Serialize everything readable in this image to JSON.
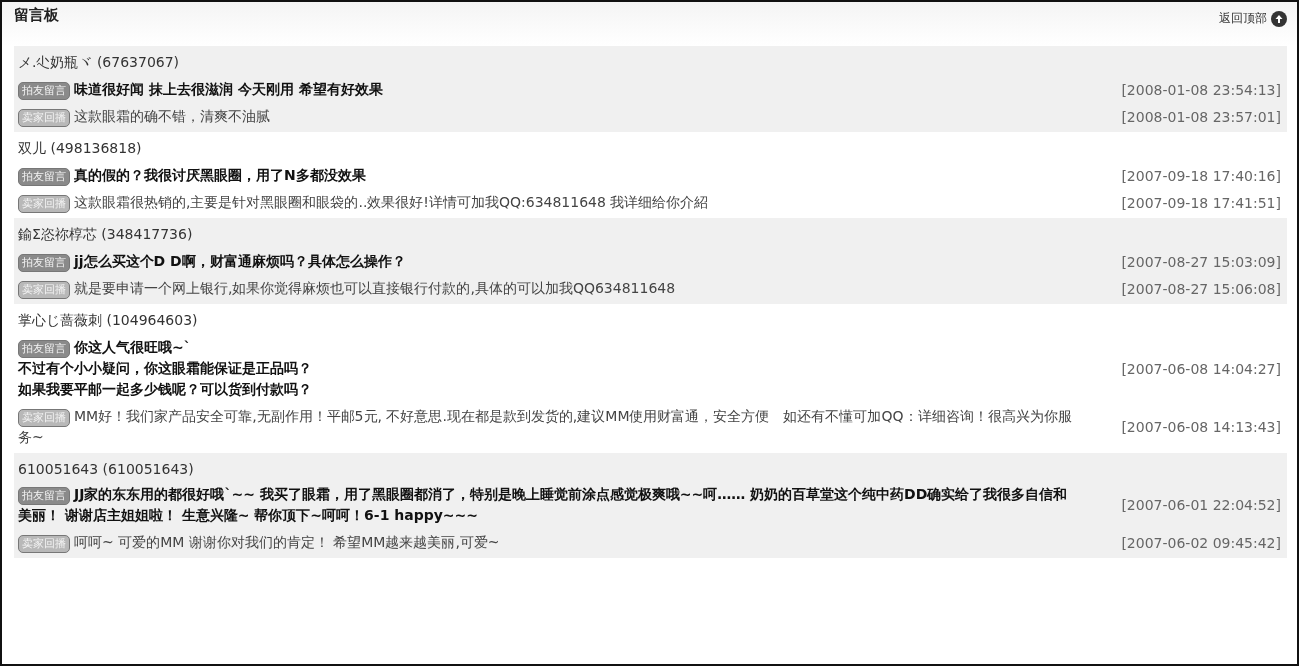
{
  "board": {
    "title": "留言板",
    "back_to_top": "返回顶部"
  },
  "threads": [
    {
      "author": "メ.尐奶瓶ヾ (67637067)",
      "messages": [
        {
          "kind": "buyer",
          "badge": "拍友留言",
          "text": "味道很好闻 抹上去很滋润 今天刚用 希望有好效果",
          "time": "[2008-01-08 23:54:13]"
        },
        {
          "kind": "seller",
          "badge": "卖家回播",
          "text": "这款眼霜的确不错，清爽不油腻",
          "time": "[2008-01-08 23:57:01]"
        }
      ]
    },
    {
      "author": "双儿 (498136818)",
      "messages": [
        {
          "kind": "buyer",
          "badge": "拍友留言",
          "text": "真的假的？我很讨厌黑眼圈，用了N多都没效果",
          "time": "[2007-09-18 17:40:16]"
        },
        {
          "kind": "seller",
          "badge": "卖家回播",
          "text": "这款眼霜很热销的,主要是针对黑眼圈和眼袋的..效果很好!详情可加我QQ:634811648 我详细给你介紹",
          "time": "[2007-09-18 17:41:51]"
        }
      ]
    },
    {
      "author": "鍮Σ恣祢椁芯 (348417736)",
      "messages": [
        {
          "kind": "buyer",
          "badge": "拍友留言",
          "text": "jj怎么买这个D D啊，财富通麻烦吗？具体怎么操作？",
          "time": "[2007-08-27 15:03:09]"
        },
        {
          "kind": "seller",
          "badge": "卖家回播",
          "text": "就是要申请一个网上银行,如果你觉得麻烦也可以直接银行付款的,具体的可以加我QQ634811648",
          "time": "[2007-08-27 15:06:08]"
        }
      ]
    },
    {
      "author": "掌心じ蔷薇刺 (104964603)",
      "messages": [
        {
          "kind": "buyer",
          "badge": "拍友留言",
          "text": "你这人气很旺哦~`",
          "extra_lines": [
            "不过有个小小疑问，你这眼霜能保证是正品吗？",
            "如果我要平邮一起多少钱呢？可以货到付款吗？"
          ],
          "time": "[2007-06-08 14:04:27]"
        },
        {
          "kind": "seller",
          "badge": "卖家回播",
          "text": "MM好！我们家产品安全可靠,无副作用！平邮5元, 不好意思.现在都是款到发货的,建议MM使用财富通，安全方便　如还有不懂可加QQ：详细咨询！很高兴为你服务~",
          "time": "[2007-06-08 14:13:43]"
        }
      ]
    },
    {
      "author": "610051643 (610051643)",
      "messages": [
        {
          "kind": "buyer",
          "badge": "拍友留言",
          "text": "JJ家的东东用的都很好哦`~~ 我买了眼霜，用了黑眼圈都消了，特别是晚上睡觉前涂点感觉极爽哦~~呵…… 奶奶的百草堂这个纯中药DD确实给了我很多自信和美丽！ 谢谢店主姐姐啦！ 生意兴隆~ 帮你顶下~呵呵！6-1 happy~~~",
          "time": "[2007-06-01 22:04:52]"
        },
        {
          "kind": "seller",
          "badge": "卖家回播",
          "text": "呵呵~ 可爱的MM  谢谢你对我们的肯定！ 希望MM越来越美丽,可爱~",
          "time": "[2007-06-02 09:45:42]"
        }
      ]
    }
  ]
}
